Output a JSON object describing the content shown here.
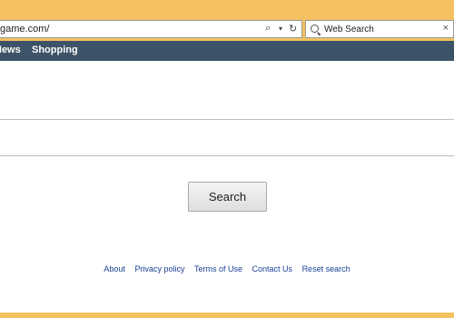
{
  "browser": {
    "address": "game.com/",
    "search_placeholder": "Web Search",
    "search_close": "×",
    "search_icon": "magnifier-icon",
    "refresh_icon": "refresh-icon",
    "frame_color": "#f3c15f"
  },
  "nav": {
    "items": [
      {
        "label": "News"
      },
      {
        "label": "Shopping"
      }
    ],
    "background": "#3d5367"
  },
  "main": {
    "search_button_label": "Search"
  },
  "footer": {
    "links": [
      {
        "label": "About"
      },
      {
        "label": "Privacy policy"
      },
      {
        "label": "Terms of Use"
      },
      {
        "label": "Contact Us"
      },
      {
        "label": "Reset search"
      }
    ],
    "link_color": "#1a3f93"
  }
}
